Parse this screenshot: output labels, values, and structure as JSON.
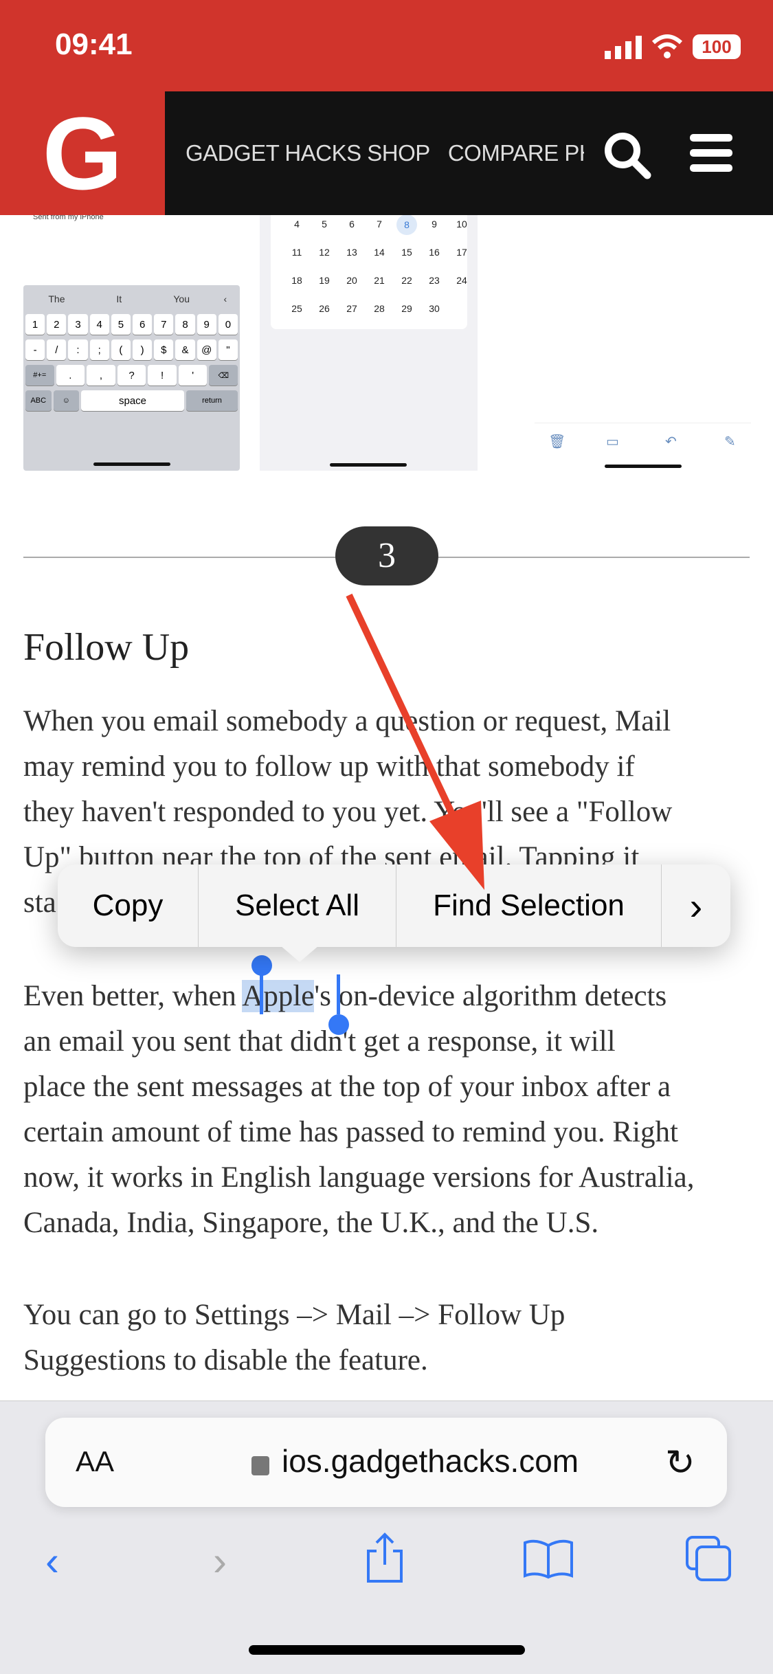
{
  "status_bar": {
    "time": "09:41",
    "battery": "100"
  },
  "header": {
    "logo": "G",
    "nav": [
      "GADGET HACKS SHOP",
      "COMPARE PHONES"
    ],
    "icons": [
      "search-icon",
      "menu-icon"
    ]
  },
  "thumbnails": {
    "left": {
      "text": "Sent from my iPhone",
      "suggestions": [
        "The",
        "It",
        "You"
      ],
      "rows": [
        [
          "1",
          "2",
          "3",
          "4",
          "5",
          "6",
          "7",
          "8",
          "9",
          "0"
        ],
        [
          "-",
          "/",
          ":",
          ";",
          "(",
          ")",
          "$",
          "&",
          "@",
          "\""
        ],
        [
          "#+=",
          ".",
          ",",
          "?",
          "!",
          "'",
          "⌫"
        ],
        [
          "ABC",
          "☺",
          "space",
          "return"
        ]
      ]
    },
    "calendar": {
      "rows": [
        [
          "4",
          "5",
          "6",
          "7",
          "8",
          "9",
          "10"
        ],
        [
          "11",
          "12",
          "13",
          "14",
          "15",
          "16",
          "17"
        ],
        [
          "18",
          "19",
          "20",
          "21",
          "22",
          "23",
          "24"
        ],
        [
          "25",
          "26",
          "27",
          "28",
          "29",
          "30"
        ]
      ],
      "selected": "8"
    }
  },
  "step_badge": "3",
  "article": {
    "heading": "Follow Up",
    "p1": [
      "When you email somebody a question or request, Mail",
      "may remind you to follow up with that somebody if",
      "they haven't responded to you yet. You'll see a \"Follow",
      "Up\" button near the top of the sent email. Tapping it",
      "sta"
    ],
    "p2_pre": "Even better, when ",
    "p2_sel": "Apple",
    "p2_post": "'s on-device algorithm detects",
    "p2": [
      "an email you sent that didn't get a response, it will",
      "place the sent messages at the top of your inbox after a",
      "certain amount of time has passed to remind you. Right",
      "now, it works in English language versions for Australia,",
      "Canada, India, Singapore, the U.K., and the U.S."
    ],
    "p3": [
      "You can go to Settings –> Mail –> Follow Up",
      "Suggestions to disable the feature."
    ]
  },
  "context_menu": {
    "items": [
      "Copy",
      "Select All",
      "Find Selection"
    ],
    "more": "›"
  },
  "annotation_color": "#e8402a",
  "browser": {
    "text_size": "AA",
    "url": "ios.gadgethacks.com",
    "icons": [
      "back-icon",
      "forward-icon",
      "share-icon",
      "bookmarks-icon",
      "tabs-icon"
    ]
  }
}
